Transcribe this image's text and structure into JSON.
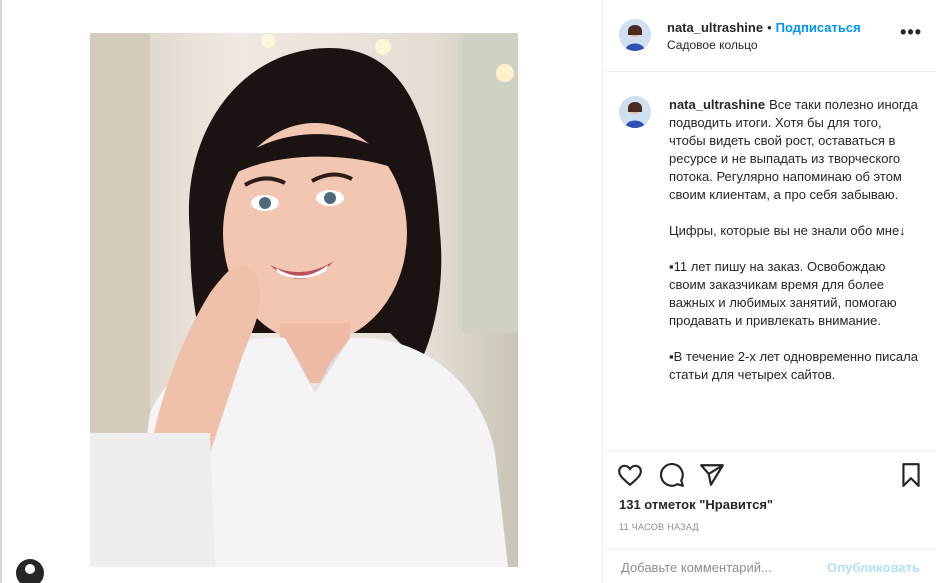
{
  "post": {
    "username": "nata_ultrashine",
    "separator": "•",
    "follow_label": "Подписаться",
    "location": "Садовое кольцо",
    "more_label": "•••"
  },
  "caption": {
    "username": "nata_ultrashine",
    "paragraphs": [
      "Все таки полезно иногда подводить итоги. Хотя бы для того, чтобы видеть свой рост, оставаться в ресурсе и не выпадать из творческого потока. Регулярно напоминаю об этом своим клиентам, а про себя забываю.",
      "Цифры, которые вы не знали обо мне↓",
      "▪11 лет пишу на заказ. Освобождаю своим заказчикам время для более важных и любимых занятий, помогаю продавать и привлекать внимание.",
      "▪В течение 2-х лет одновременно писала статьи для четырех сайтов."
    ]
  },
  "stats": {
    "likes": "131 отметок \"Нравится\"",
    "time": "11 ЧАСОВ НАЗАД"
  },
  "comment": {
    "placeholder": "Добавьте комментарий...",
    "post_label": "Опубликовать"
  },
  "icons": {
    "like": "heart-icon",
    "comment": "comment-bubble-icon",
    "share": "paper-plane-icon",
    "save": "bookmark-icon"
  },
  "colors": {
    "accent": "#0095f6",
    "muted": "#8e8e8e",
    "post_disabled": "#b2dffc"
  }
}
